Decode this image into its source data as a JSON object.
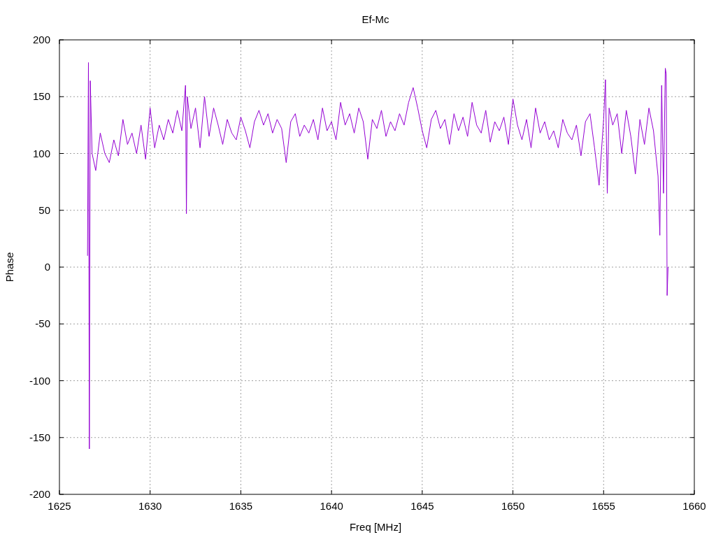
{
  "chart_data": {
    "type": "line",
    "title": "Ef-Mc",
    "grid": true,
    "xlabel": "Freq [MHz]",
    "ylabel": "Phase",
    "xlim": [
      1625,
      1660
    ],
    "ylim": [
      -200,
      200
    ],
    "xticks": [
      1625,
      1630,
      1635,
      1640,
      1645,
      1650,
      1655,
      1660
    ],
    "yticks": [
      -200,
      -150,
      -100,
      -50,
      0,
      50,
      100,
      150,
      200
    ],
    "x": [
      1626.55,
      1626.6,
      1626.65,
      1626.7,
      1626.8,
      1627.0,
      1627.25,
      1627.5,
      1627.75,
      1628.0,
      1628.25,
      1628.5,
      1628.75,
      1629.0,
      1629.25,
      1629.5,
      1629.75,
      1630.0,
      1630.25,
      1630.5,
      1630.75,
      1631.0,
      1631.25,
      1631.5,
      1631.75,
      1631.95,
      1632.0,
      1632.05,
      1632.25,
      1632.5,
      1632.75,
      1633.0,
      1633.25,
      1633.5,
      1633.75,
      1634.0,
      1634.25,
      1634.5,
      1634.75,
      1635.0,
      1635.25,
      1635.5,
      1635.75,
      1636.0,
      1636.25,
      1636.5,
      1636.75,
      1637.0,
      1637.25,
      1637.5,
      1637.75,
      1638.0,
      1638.25,
      1638.5,
      1638.75,
      1639.0,
      1639.25,
      1639.5,
      1639.75,
      1640.0,
      1640.25,
      1640.5,
      1640.75,
      1641.0,
      1641.25,
      1641.5,
      1641.75,
      1642.0,
      1642.25,
      1642.5,
      1642.75,
      1643.0,
      1643.25,
      1643.5,
      1643.75,
      1644.0,
      1644.25,
      1644.5,
      1644.75,
      1645.0,
      1645.25,
      1645.5,
      1645.75,
      1646.0,
      1646.25,
      1646.5,
      1646.75,
      1647.0,
      1647.25,
      1647.5,
      1647.75,
      1648.0,
      1648.25,
      1648.5,
      1648.75,
      1649.0,
      1649.25,
      1649.5,
      1649.75,
      1650.0,
      1650.25,
      1650.5,
      1650.75,
      1651.0,
      1651.25,
      1651.5,
      1651.75,
      1652.0,
      1652.25,
      1652.5,
      1652.75,
      1653.0,
      1653.25,
      1653.5,
      1653.75,
      1654.0,
      1654.25,
      1654.5,
      1654.75,
      1655.0,
      1655.1,
      1655.2,
      1655.3,
      1655.5,
      1655.75,
      1656.0,
      1656.25,
      1656.5,
      1656.75,
      1657.0,
      1657.25,
      1657.5,
      1657.75,
      1658.0,
      1658.1,
      1658.2,
      1658.3,
      1658.4,
      1658.45,
      1658.5,
      1658.55
    ],
    "series": [
      {
        "color": "#9400d3",
        "values": [
          10,
          180,
          -160,
          164,
          100,
          85,
          118,
          100,
          92,
          112,
          98,
          130,
          108,
          118,
          100,
          125,
          95,
          140,
          105,
          125,
          112,
          130,
          118,
          138,
          120,
          160,
          47,
          150,
          122,
          140,
          105,
          150,
          115,
          140,
          125,
          108,
          130,
          118,
          112,
          132,
          120,
          105,
          128,
          138,
          125,
          135,
          118,
          130,
          122,
          92,
          128,
          135,
          115,
          125,
          118,
          130,
          112,
          140,
          120,
          128,
          112,
          145,
          125,
          135,
          118,
          140,
          128,
          95,
          130,
          122,
          138,
          115,
          128,
          120,
          135,
          125,
          145,
          158,
          140,
          120,
          105,
          130,
          138,
          122,
          130,
          108,
          135,
          120,
          132,
          115,
          145,
          125,
          118,
          138,
          110,
          128,
          120,
          132,
          108,
          148,
          125,
          112,
          130,
          105,
          140,
          118,
          128,
          112,
          120,
          105,
          130,
          118,
          112,
          125,
          98,
          128,
          135,
          105,
          72,
          130,
          165,
          65,
          140,
          125,
          135,
          100,
          138,
          115,
          82,
          130,
          108,
          140,
          120,
          80,
          28,
          160,
          65,
          175,
          170,
          -25,
          0
        ]
      }
    ]
  }
}
